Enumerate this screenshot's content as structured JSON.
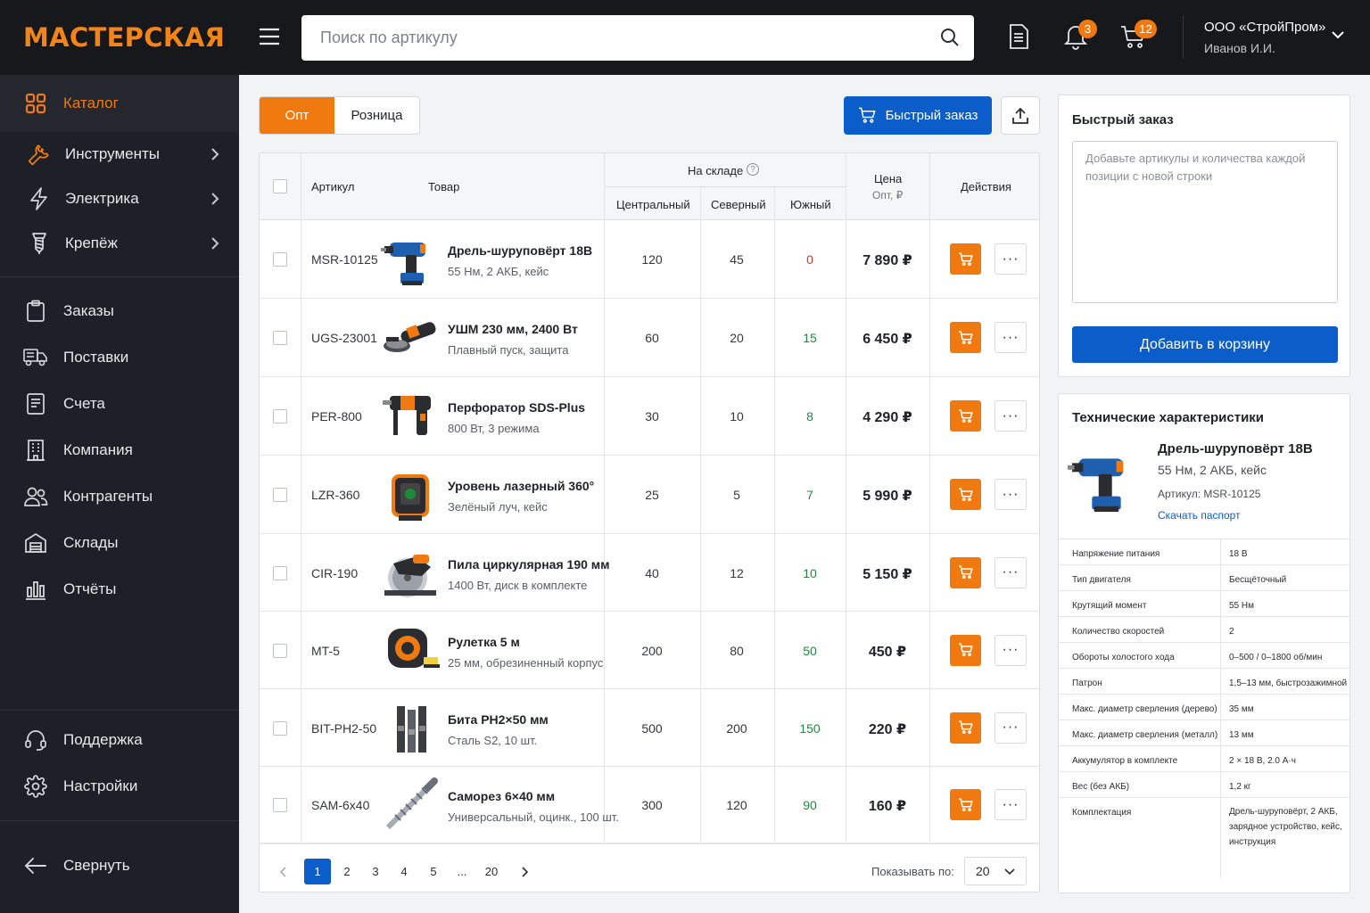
{
  "brand": {
    "logo": "МАСТЕРСКАЯ",
    "accent": "#f07a10",
    "primary": "#0b5ec9",
    "sidebar_bg": "#1d2026"
  },
  "sidebar": {
    "catalog": {
      "label": "Каталог",
      "icon": "grid-icon"
    },
    "sub_items": [
      {
        "label": "Инструменты",
        "icon": "wrench-icon"
      },
      {
        "label": "Электрика",
        "icon": "lightning-icon"
      },
      {
        "label": "Крепёж",
        "icon": "screw-icon"
      }
    ],
    "items": [
      {
        "label": "Заказы",
        "icon": "clipboard-icon"
      },
      {
        "label": "Поставки",
        "icon": "truck-icon"
      },
      {
        "label": "Счета",
        "icon": "invoice-icon"
      },
      {
        "label": "Компания",
        "icon": "building-icon"
      },
      {
        "label": "Контрагенты",
        "icon": "users-icon"
      },
      {
        "label": "Склады",
        "icon": "warehouse-icon"
      },
      {
        "label": "Отчёты",
        "icon": "report-icon"
      }
    ],
    "bottom": [
      {
        "label": "Поддержка",
        "icon": "headset-icon"
      },
      {
        "label": "Настройки",
        "icon": "gear-icon"
      }
    ],
    "collapse": {
      "label": "Свернуть",
      "icon": "arrow-left-icon"
    }
  },
  "topbar": {
    "search_placeholder": "Поиск по артикулу",
    "notifications_count": "3",
    "cart_count": "12",
    "company_name": "ООО «СтройПром»",
    "user_name": "Иванов И.И."
  },
  "tabs": [
    "Опт",
    "Розница"
  ],
  "quick_order_button": "Быстрый заказ",
  "table": {
    "headers": {
      "article": "Артикул",
      "product": "Товар",
      "stock": "На складе",
      "central": "Центральный",
      "north": "Северный",
      "south": "Южный",
      "price": "Цена",
      "price_sub": "Опт, ₽",
      "actions": "Действия"
    },
    "rows": [
      {
        "article": "MSR-10125",
        "name": "Дрель-шуруповёрт 18В",
        "desc": "55 Нм, 2 АКБ, кейс",
        "central": "120",
        "north": "45",
        "south": "0",
        "south_color": "#e0301e",
        "price": "7 890 ₽",
        "img": "drill"
      },
      {
        "article": "UGS-23001",
        "name": "УШМ 230 мм, 2400 Вт",
        "desc": "Плавный пуск, защита",
        "central": "60",
        "north": "20",
        "south": "15",
        "south_color": "#1e8a3c",
        "price": "6 450 ₽",
        "img": "grinder"
      },
      {
        "article": "PER-800",
        "name": "Перфоратор SDS-Plus",
        "desc": "800 Вт, 3 режима",
        "central": "30",
        "north": "10",
        "south": "8",
        "south_color": "#1e8a3c",
        "price": "4 290 ₽",
        "img": "hammer"
      },
      {
        "article": "LZR-360",
        "name": "Уровень лазерный 360°",
        "desc": "Зелёный луч, кейс",
        "central": "25",
        "north": "5",
        "south": "7",
        "south_color": "#1e8a3c",
        "price": "5 990 ₽",
        "img": "laser"
      },
      {
        "article": "CIR-190",
        "name": "Пила циркулярная 190 мм",
        "desc": "1400 Вт, диск в комплекте",
        "central": "40",
        "north": "12",
        "south": "10",
        "south_color": "#1e8a3c",
        "price": "5 150 ₽",
        "img": "saw"
      },
      {
        "article": "MT-5",
        "name": "Рулетка 5 м",
        "desc": "25 мм, обрезиненный корпус",
        "central": "200",
        "north": "80",
        "south": "50",
        "south_color": "#1e8a3c",
        "price": "450 ₽",
        "img": "tape"
      },
      {
        "article": "BIT-PH2-50",
        "name": "Бита PH2×50 мм",
        "desc": "Сталь S2, 10 шт.",
        "central": "500",
        "north": "200",
        "south": "150",
        "south_color": "#1e8a3c",
        "price": "220 ₽",
        "img": "bits"
      },
      {
        "article": "SAM-6x40",
        "name": "Саморез 6×40 мм",
        "desc": "Универсальный, оцинк., 100 шт.",
        "central": "300",
        "north": "120",
        "south": "90",
        "south_color": "#1e8a3c",
        "price": "160 ₽",
        "img": "screw"
      }
    ]
  },
  "pagination": {
    "pages": [
      "1",
      "2",
      "3",
      "4",
      "5",
      "...",
      "20"
    ],
    "current": "1",
    "per_page_label": "Показывать по:",
    "per_page": "20"
  },
  "quick_order": {
    "title": "Быстрый заказ",
    "placeholder": "Добавьте артикулы и количества каждой позиции с новой строки",
    "button": "Добавить в корзину"
  },
  "specs": {
    "title": "Технические характеристики",
    "product_name": "Дрель-шуруповёрт 18В",
    "product_desc": "55 Нм, 2 АКБ, кейс",
    "article": "Артикул: MSR-10125",
    "download": "Скачать паспорт",
    "rows": [
      {
        "k": "Напряжение питания",
        "v": "18 В"
      },
      {
        "k": "Тип двигателя",
        "v": "Бесщёточный"
      },
      {
        "k": "Крутящий момент",
        "v": "55 Нм"
      },
      {
        "k": "Количество скоростей",
        "v": "2"
      },
      {
        "k": "Обороты холостого хода",
        "v": "0–500 / 0–1800 об/мин"
      },
      {
        "k": "Патрон",
        "v": "1,5–13 мм, быстрозажимной"
      },
      {
        "k": "Макс. диаметр сверления (дерево)",
        "v": "35 мм"
      },
      {
        "k": "Макс. диаметр сверления (металл)",
        "v": "13 мм"
      },
      {
        "k": "Аккумулятор в комплекте",
        "v": "2 × 18 В, 2.0 А·ч"
      },
      {
        "k": "Вес (без АКБ)",
        "v": "1,2 кг"
      },
      {
        "k": "Комплектация",
        "v": "Дрель-шуруповёрт, 2 АКБ, зарядное устройство, кейс, инструкция"
      }
    ]
  }
}
